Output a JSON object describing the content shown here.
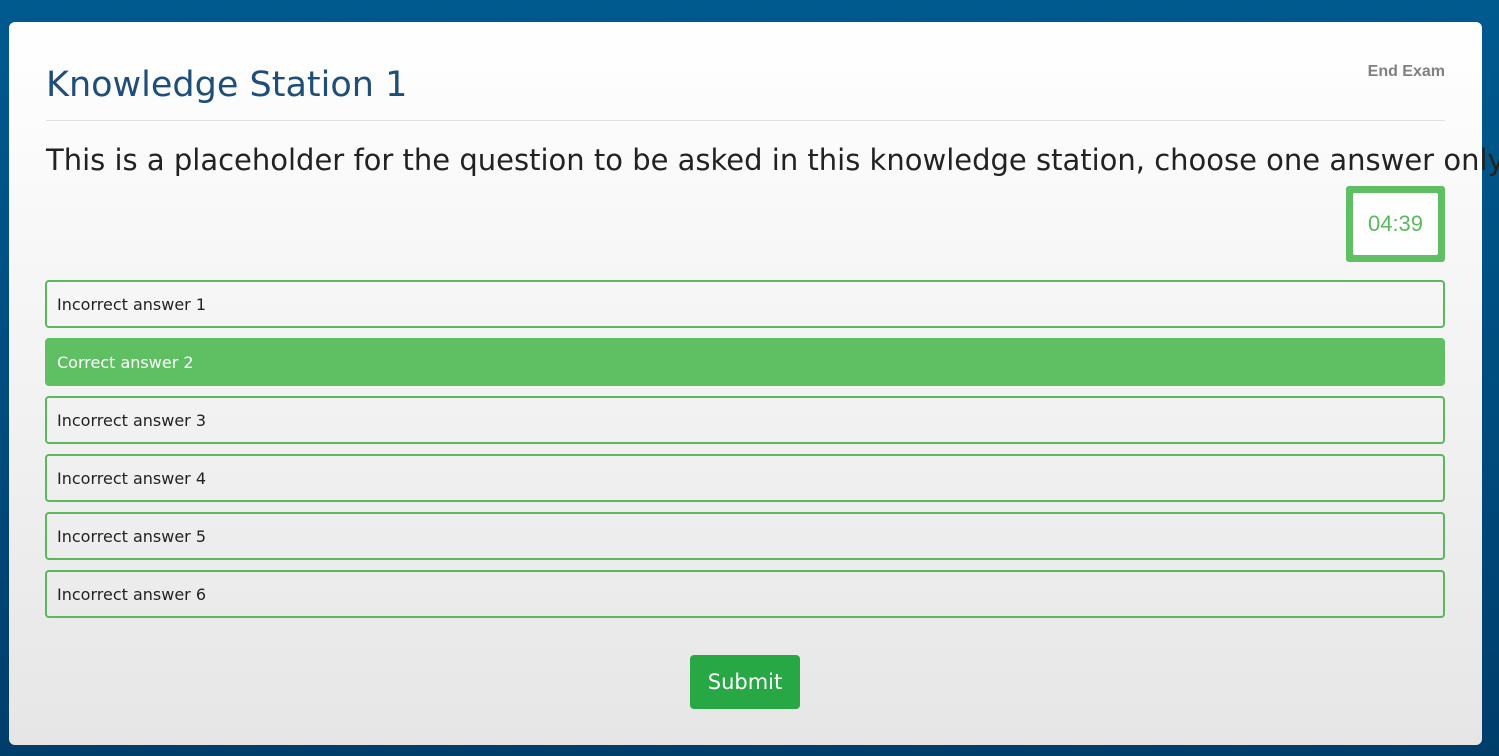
{
  "header": {
    "title": "Knowledge Station 1",
    "end_exam_label": "End Exam"
  },
  "question": {
    "text": "This is a placeholder for the question to be asked in this knowledge station, choose one answer only"
  },
  "timer": {
    "value": "04:39"
  },
  "answers": [
    {
      "label": "Incorrect answer 1",
      "selected": false
    },
    {
      "label": "Correct answer 2",
      "selected": true
    },
    {
      "label": "Incorrect answer 3",
      "selected": false
    },
    {
      "label": "Incorrect answer 4",
      "selected": false
    },
    {
      "label": "Incorrect answer 5",
      "selected": false
    },
    {
      "label": "Incorrect answer 6",
      "selected": false
    }
  ],
  "submit": {
    "label": "Submit"
  },
  "colors": {
    "title": "#1f4e79",
    "accent_green": "#5cb85c",
    "selected_bg": "#5fbf63",
    "submit_bg": "#28a745",
    "background": "#005a8f"
  }
}
